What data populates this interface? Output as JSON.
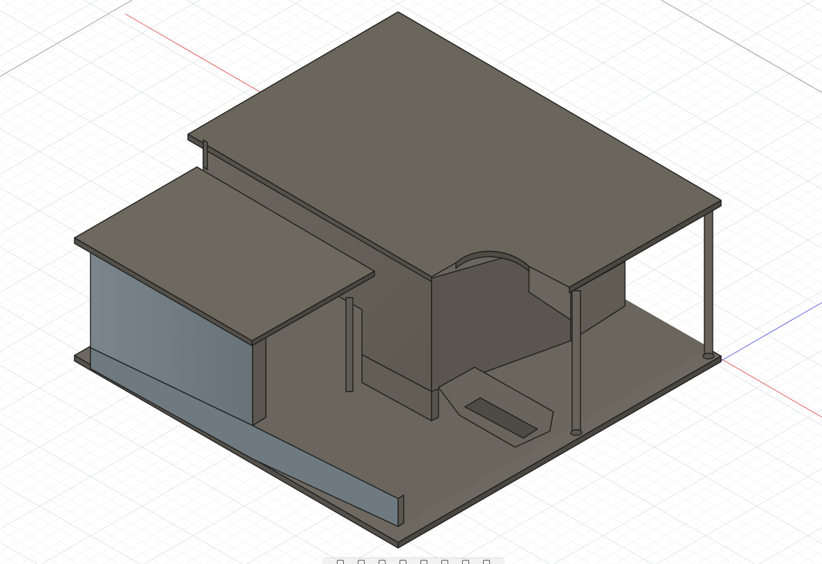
{
  "viewport": {
    "background": "#ffffff",
    "grid_minor_color": "#e6e8ea",
    "grid_major_color": "#cfd3d7",
    "axis_x_color": "#e05a5a",
    "axis_z_color": "#6a6ae0",
    "axis_y_color": "#9a9a9a"
  },
  "model": {
    "body_color": "#6b665c",
    "shadow_side_color": "#58544c",
    "blue_side_color": "#6e7b80",
    "edge_color": "#1e1e1e"
  },
  "nav_toolbar": {
    "tools": [
      {
        "name": "orbit-icon"
      },
      {
        "name": "look-at-icon"
      },
      {
        "name": "pan-icon"
      },
      {
        "name": "zoom-icon"
      },
      {
        "name": "fit-icon"
      },
      {
        "name": "display-settings-icon"
      },
      {
        "name": "grid-settings-icon"
      },
      {
        "name": "viewports-icon"
      }
    ]
  }
}
